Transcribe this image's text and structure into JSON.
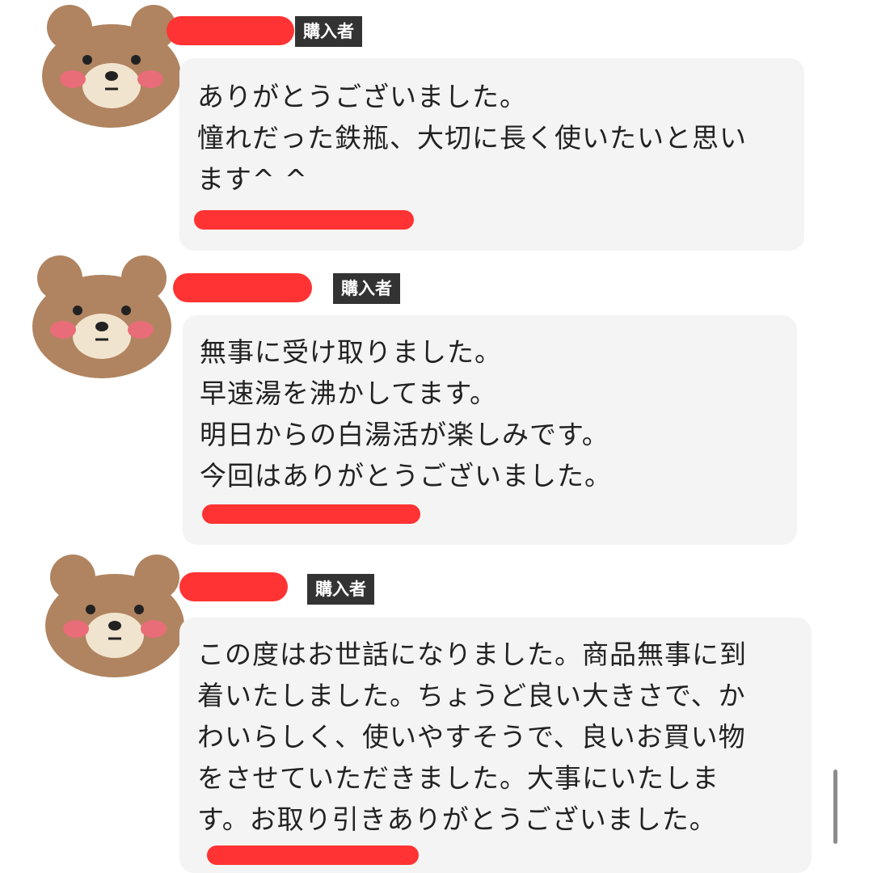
{
  "messages": [
    {
      "badge": "購入者",
      "lines": [
        "ありがとうございました。",
        "憧れだった鉄瓶、大切に長く使いたいと思い",
        "ます^ ^"
      ]
    },
    {
      "badge": "購入者",
      "lines": [
        "無事に受け取りました。",
        "早速湯を沸かしてます。",
        "明日からの白湯活が楽しみです。",
        "今回はありがとうございました。"
      ]
    },
    {
      "badge": "購入者",
      "lines": [
        "この度はお世話になりました。商品無事に到",
        "着いたしました。ちょうど良い大きさで、か",
        "わいらしく、使いやすそうで、良いお買い物",
        "をさせていただきました。大事にいたしま",
        "す。お取り引きありがとうございました。"
      ]
    }
  ],
  "colors": {
    "redaction": "#ff3333",
    "bubble": "#f4f4f4",
    "badge": "#333333"
  }
}
